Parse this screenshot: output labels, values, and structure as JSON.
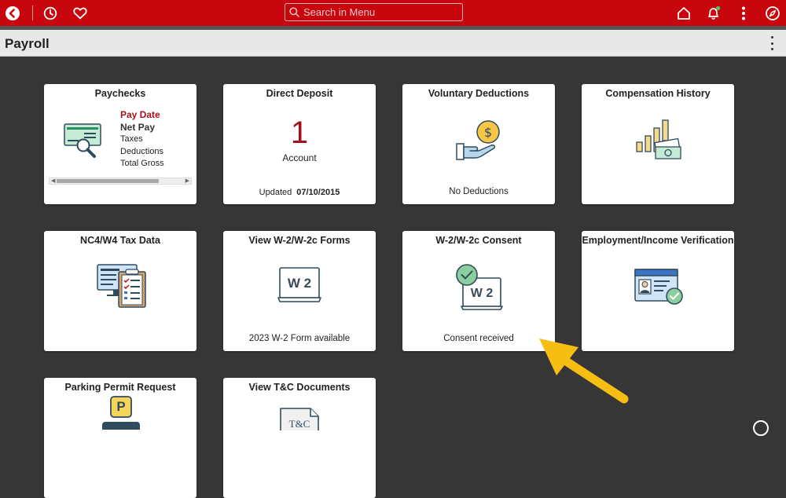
{
  "header": {
    "search_placeholder": "Search in Menu",
    "notification_dot_color": "#3ecf6a",
    "brand_color": "#c8060d"
  },
  "page": {
    "title": "Payroll"
  },
  "tiles": {
    "paychecks": {
      "title": "Paychecks",
      "items": [
        "Pay Date",
        "Net Pay",
        "Taxes",
        "Deductions",
        "Total Gross"
      ]
    },
    "direct_deposit": {
      "title": "Direct Deposit",
      "count": "1",
      "count_label": "Account",
      "updated_label": "Updated",
      "updated_date": "07/10/2015"
    },
    "voluntary_deductions": {
      "title": "Voluntary Deductions",
      "footer": "No Deductions"
    },
    "compensation_history": {
      "title": "Compensation History"
    },
    "nc4_w4": {
      "title": "NC4/W4 Tax Data"
    },
    "w2_forms": {
      "title": "View W-2/W-2c Forms",
      "icon_text": "W 2",
      "footer": "2023 W-2 Form available"
    },
    "w2_consent": {
      "title": "W-2/W-2c Consent",
      "icon_text": "W 2",
      "footer": "Consent received"
    },
    "employment_verification": {
      "title": "Employment/Income Verification"
    },
    "parking_permit": {
      "title": "Parking Permit Request",
      "icon_text": "P"
    },
    "tc_documents": {
      "title": "View T&C Documents",
      "icon_text": "T&C"
    }
  },
  "annotation": {
    "arrow_color": "#f6be12"
  }
}
